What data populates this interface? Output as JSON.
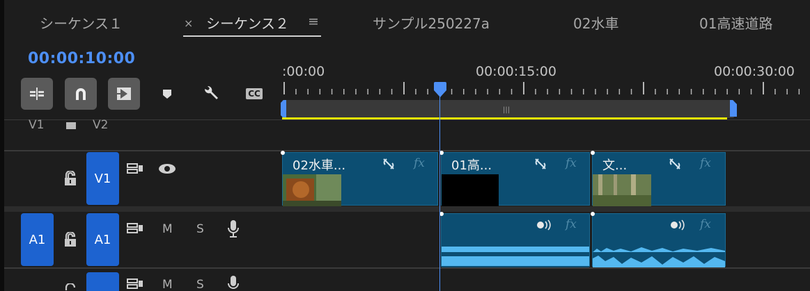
{
  "tabs": [
    {
      "label": "シーケンス１",
      "active": false
    },
    {
      "label": "シーケンス２",
      "active": true,
      "close": "×",
      "menu": "≡"
    },
    {
      "label": "サンプル250227a",
      "active": false
    },
    {
      "label": "02水車",
      "active": false
    },
    {
      "label": "01高速道路",
      "active": false
    }
  ],
  "timecode": "00:00:10:00",
  "toolbar": {
    "icons": [
      "insert-sequence-nest-icon",
      "snap-magnet-icon",
      "linked-selection-icon",
      "add-marker-icon",
      "wrench-settings-icon",
      "captions-icon"
    ],
    "captions_label": "CC"
  },
  "ruler": {
    "labels": [
      ":00:00",
      "00:00:15:00",
      "00:00:30:00"
    ]
  },
  "tracks": {
    "top_partial": {
      "left_label": "V1",
      "right_label": "V2"
    },
    "v1": {
      "source_label": "V1",
      "mute_label": "",
      "solo_label": ""
    },
    "a1": {
      "source_label": "A1",
      "target_label": "A1",
      "m_label": "M",
      "s_label": "S"
    },
    "a2": {
      "m_label": "M",
      "s_label": "S"
    }
  },
  "clips": {
    "video": [
      {
        "name": "02水車...",
        "fx": "fx"
      },
      {
        "name": "01高...",
        "fx": "fx"
      },
      {
        "name": "文...",
        "fx": "fx"
      }
    ],
    "audio": [
      {
        "fx": "fx"
      },
      {
        "fx": "fx"
      }
    ]
  },
  "colors": {
    "accent": "#4d8ff5",
    "clip": "#0c4e72",
    "track_target": "#1d63d0",
    "work_area": "#e6e600",
    "waveform": "#54b8f0"
  }
}
